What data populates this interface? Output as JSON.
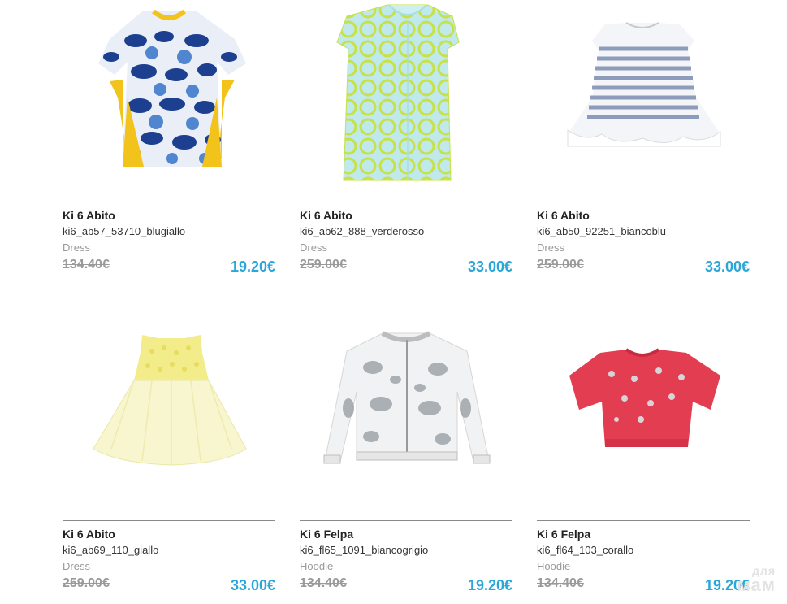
{
  "products": [
    {
      "title": "Ki 6 Abito",
      "sku": "ki6_ab57_53710_blugiallo",
      "category": "Dress",
      "old_price": "134.40€",
      "price": "19.20€",
      "image": "dress-blue-yellow-floral"
    },
    {
      "title": "Ki 6 Abito",
      "sku": "ki6_ab62_888_verderosso",
      "category": "Dress",
      "old_price": "259.00€",
      "price": "33.00€",
      "image": "dress-green-polka-dot"
    },
    {
      "title": "Ki 6 Abito",
      "sku": "ki6_ab50_92251_biancoblu",
      "category": "Dress",
      "old_price": "259.00€",
      "price": "33.00€",
      "image": "dress-white-blue-stripe-lace"
    },
    {
      "title": "Ki 6 Abito",
      "sku": "ki6_ab69_110_giallo",
      "category": "Dress",
      "old_price": "259.00€",
      "price": "33.00€",
      "image": "dress-yellow-tulle"
    },
    {
      "title": "Ki 6 Felpa",
      "sku": "ki6_fl65_1091_biancogrigio",
      "category": "Hoodie",
      "old_price": "134.40€",
      "price": "19.20€",
      "image": "jacket-white-grey-floral"
    },
    {
      "title": "Ki 6 Felpa",
      "sku": "ki6_fl64_103_corallo",
      "category": "Hoodie",
      "old_price": "134.40€",
      "price": "19.20€",
      "image": "top-coral-sequin"
    }
  ],
  "watermark": {
    "line1": "для",
    "line2": "мам"
  },
  "colors": {
    "price": "#2aa6d8",
    "old_price": "#9a9a9a",
    "divider": "#8a8a8a"
  }
}
